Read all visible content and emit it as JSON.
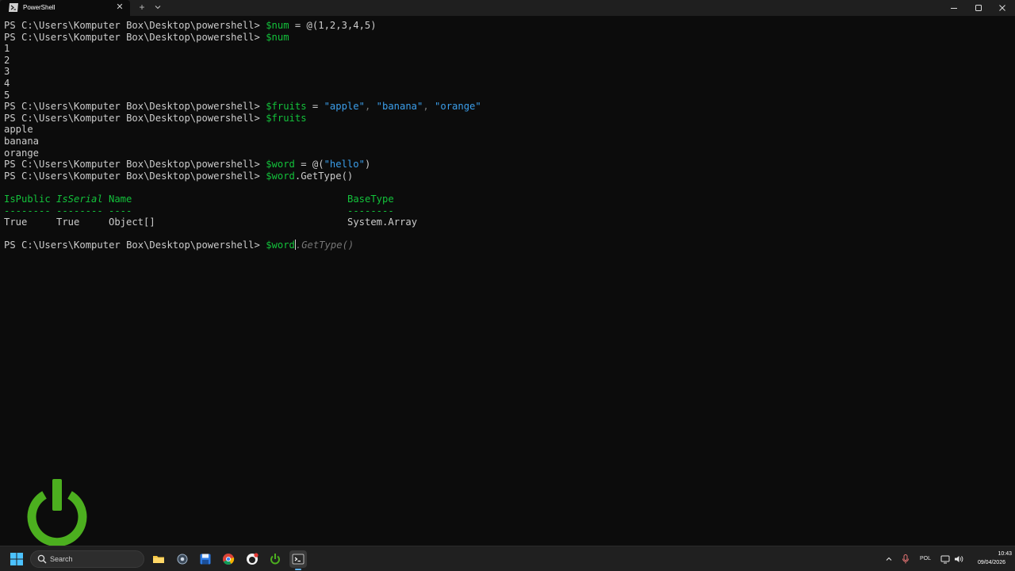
{
  "window": {
    "tab_title": "PowerShell",
    "new_tab_symbol": "+",
    "close_symbol": "✕"
  },
  "terminal": {
    "prompt": "PS C:\\Users\\Komputer Box\\Desktop\\powershell> ",
    "lines": [
      {
        "type": "cmd",
        "var": "$num",
        "rest1": " = @(1,2,3,4,5)"
      },
      {
        "type": "cmd",
        "var": "$num",
        "rest1": ""
      },
      {
        "type": "out",
        "text": "1"
      },
      {
        "type": "out",
        "text": "2"
      },
      {
        "type": "out",
        "text": "3"
      },
      {
        "type": "out",
        "text": "4"
      },
      {
        "type": "out",
        "text": "5"
      },
      {
        "type": "cmd",
        "var": "$fruits",
        "rest1": " = ",
        "str1": "\"apple\"",
        "sep1": ", ",
        "str2": "\"banana\"",
        "sep2": ", ",
        "str3": "\"orange\""
      },
      {
        "type": "cmd",
        "var": "$fruits",
        "rest1": ""
      },
      {
        "type": "out",
        "text": "apple"
      },
      {
        "type": "out",
        "text": "banana"
      },
      {
        "type": "out",
        "text": "orange"
      },
      {
        "type": "cmd",
        "var": "$word",
        "rest1": " = @(",
        "str1": "\"hello\"",
        "rest2": ")"
      },
      {
        "type": "cmd",
        "var": "$word",
        "rest1": ".GetType()"
      }
    ],
    "table": {
      "headers": [
        "IsPublic",
        "IsSerial",
        "Name",
        "BaseType"
      ],
      "underlines": [
        "--------",
        "--------",
        "----",
        "--------"
      ],
      "row": [
        "True",
        "True",
        "Object[]",
        "System.Array"
      ]
    },
    "current": {
      "var": "$word",
      "suggestion": ".GetType()"
    }
  },
  "taskbar": {
    "search_placeholder": "Search",
    "apps": [
      "file-explorer",
      "settings",
      "save-app",
      "chrome",
      "github-desktop",
      "power-app",
      "terminal"
    ],
    "language": "POL",
    "time": "10:43",
    "date": "09/04/2026"
  },
  "colors": {
    "background": "#0c0c0c",
    "green": "#13c23b",
    "string_blue": "#3b9eea",
    "text": "#cccccc",
    "logo_green": "#4caf1f"
  }
}
